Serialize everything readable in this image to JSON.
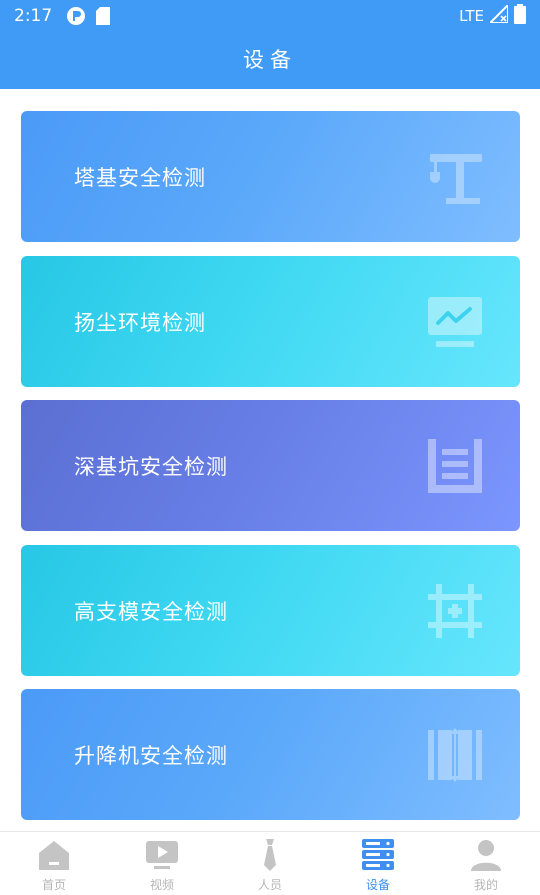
{
  "status": {
    "time": "2:17",
    "network": "LTE"
  },
  "header": {
    "title": "设备"
  },
  "cards": [
    {
      "label": "塔基安全检测",
      "icon": "tower-crane-icon"
    },
    {
      "label": "扬尘环境检测",
      "icon": "monitor-chart-icon"
    },
    {
      "label": "深基坑安全检测",
      "icon": "pit-icon"
    },
    {
      "label": "高支模安全检测",
      "icon": "scaffold-grid-icon"
    },
    {
      "label": "升降机安全检测",
      "icon": "elevator-icon"
    }
  ],
  "nav": {
    "items": [
      {
        "label": "首页",
        "icon": "home-icon",
        "active": false
      },
      {
        "label": "视频",
        "icon": "video-icon",
        "active": false
      },
      {
        "label": "人员",
        "icon": "tie-icon",
        "active": false
      },
      {
        "label": "设备",
        "icon": "server-icon",
        "active": true
      },
      {
        "label": "我的",
        "icon": "user-icon",
        "active": false
      }
    ]
  },
  "colors": {
    "header": "#3f9bf5",
    "active_tab": "#3f8ff0",
    "inactive_tab": "#b6b6b6"
  }
}
